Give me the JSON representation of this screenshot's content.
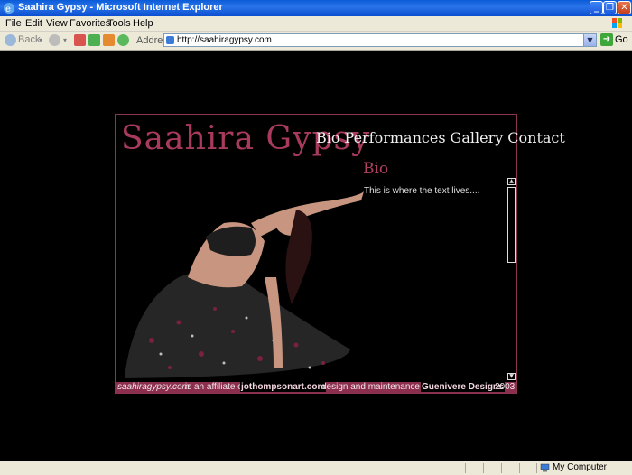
{
  "window": {
    "title": "Saahira Gypsy - Microsoft Internet Explorer"
  },
  "menu": [
    "File",
    "Edit",
    "View",
    "Favorites",
    "Tools",
    "Help"
  ],
  "toolbar": {
    "back_label": "Back",
    "address_label": "Address",
    "url": "http://saahiragypsy.com",
    "go_label": "Go"
  },
  "site": {
    "logo": "Saahira Gypsy",
    "nav": [
      "Bio",
      "Performances",
      "Gallery",
      "Contact"
    ],
    "section_title": "Bio",
    "body_text": "This is where the text lives....",
    "footer": {
      "domain": "saahiragypsy.com",
      "affiliate_text": "is an affiliate of",
      "affiliate_link": "jothompsonart.com",
      "design_text": "design and maintenance by",
      "designer": "Guenivere Designs",
      "year": "2003"
    }
  },
  "status": {
    "zone": "My Computer"
  },
  "colors": {
    "accent": "#a83a5c",
    "footer_bg": "#8c2f4f",
    "titlebar": "#0a5bd8"
  },
  "icons": [
    "ie-icon",
    "minimize-icon",
    "maximize-icon",
    "close-icon",
    "back-icon",
    "forward-icon",
    "stop-icon",
    "refresh-icon",
    "home-icon",
    "page-icon",
    "go-icon",
    "computer-icon",
    "windows-flag-icon"
  ]
}
